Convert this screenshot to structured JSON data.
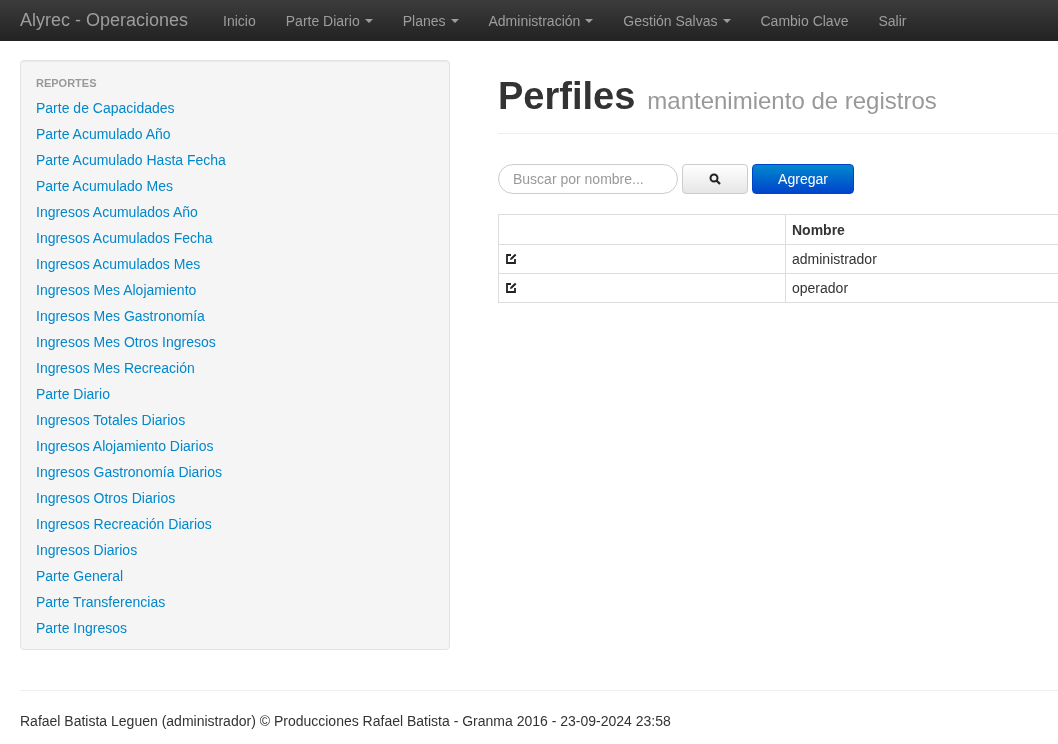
{
  "navbar": {
    "brand": "Alyrec - Operaciones",
    "items": [
      {
        "label": "Inicio",
        "has_menu": false
      },
      {
        "label": "Parte Diario",
        "has_menu": true
      },
      {
        "label": "Planes",
        "has_menu": true
      },
      {
        "label": "Administración",
        "has_menu": true
      },
      {
        "label": "Gestión Salvas",
        "has_menu": true
      },
      {
        "label": "Cambio Clave",
        "has_menu": false
      },
      {
        "label": "Salir",
        "has_menu": false
      }
    ]
  },
  "sidebar": {
    "heading": "REPORTES",
    "items": [
      "Parte de Capacidades",
      "Parte Acumulado Año",
      "Parte Acumulado Hasta Fecha",
      "Parte Acumulado Mes",
      "Ingresos Acumulados Año",
      "Ingresos Acumulados Fecha",
      "Ingresos Acumulados Mes",
      "Ingresos Mes Alojamiento",
      "Ingresos Mes Gastronomía",
      "Ingresos Mes Otros Ingresos",
      "Ingresos Mes Recreación",
      "Parte Diario",
      "Ingresos Totales Diarios",
      "Ingresos Alojamiento Diarios",
      "Ingresos Gastronomía Diarios",
      "Ingresos Otros Diarios",
      "Ingresos Recreación Diarios",
      "Ingresos Diarios",
      "Parte General",
      "Parte Transferencias",
      "Parte Ingresos"
    ]
  },
  "page": {
    "title": "Perfiles",
    "subtitle": "mantenimiento de registros"
  },
  "search": {
    "placeholder": "Buscar por nombre..."
  },
  "add_button": "Agregar",
  "table": {
    "columns": [
      "Nombre"
    ],
    "rows": [
      {
        "name": "administrador"
      },
      {
        "name": "operador"
      }
    ]
  },
  "footer": "Rafael Batista Leguen (administrador) © Producciones Rafael Batista - Granma 2016 - 23-09-2024 23:58"
}
